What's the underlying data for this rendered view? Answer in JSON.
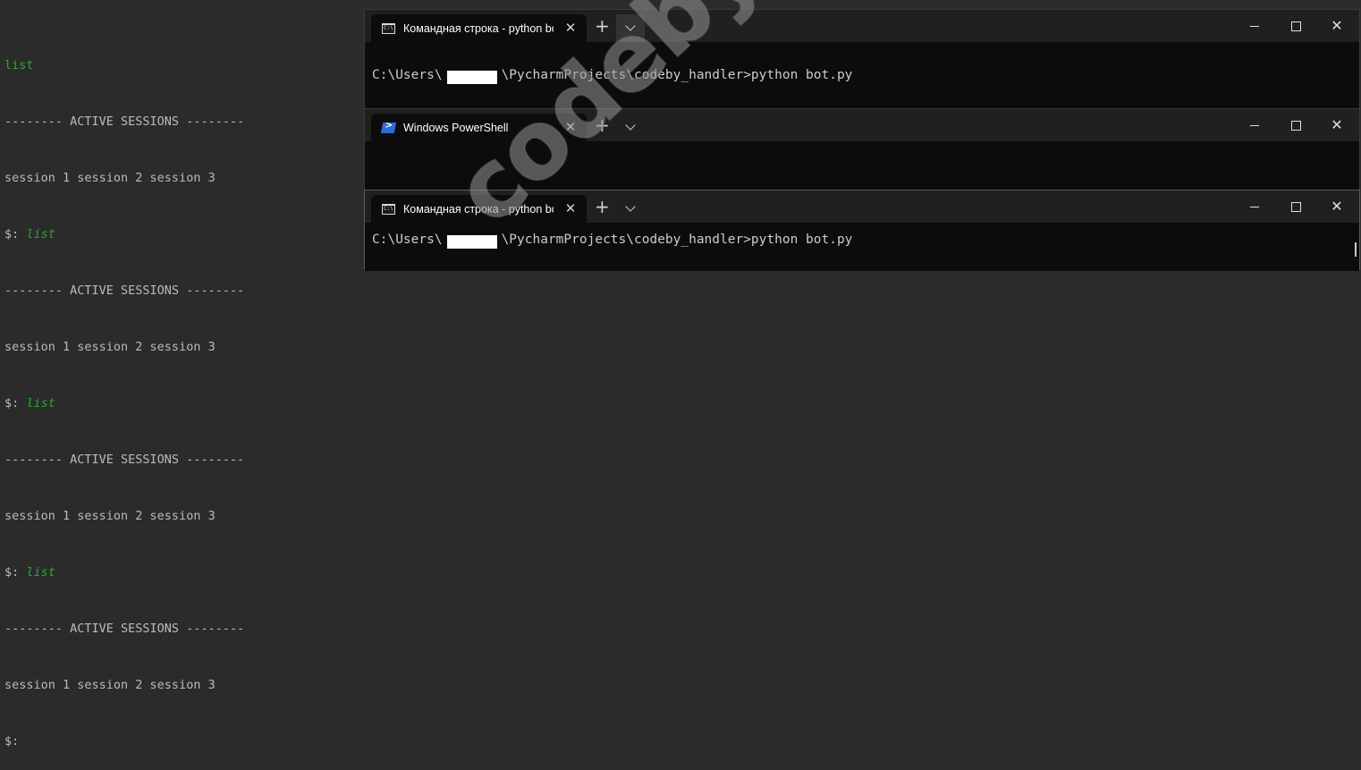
{
  "console": {
    "lines": [
      {
        "text": "list",
        "style": "cmd"
      },
      {
        "text": "-------- ACTIVE SESSIONS --------",
        "style": "plain"
      },
      {
        "text": "session 1 session 2 session 3",
        "style": "plain"
      },
      {
        "prompt": "$: ",
        "text": "list",
        "style": "prompt"
      },
      {
        "text": "-------- ACTIVE SESSIONS --------",
        "style": "plain"
      },
      {
        "text": "session 1 session 2 session 3",
        "style": "plain"
      },
      {
        "prompt": "$: ",
        "text": "list",
        "style": "prompt"
      },
      {
        "text": "-------- ACTIVE SESSIONS --------",
        "style": "plain"
      },
      {
        "text": "session 1 session 2 session 3",
        "style": "plain"
      },
      {
        "prompt": "$: ",
        "text": "list",
        "style": "prompt"
      },
      {
        "text": "-------- ACTIVE SESSIONS --------",
        "style": "plain"
      },
      {
        "text": "session 1 session 2 session 3",
        "style": "plain"
      },
      {
        "prompt": "$:",
        "text": "",
        "style": "prompt"
      }
    ]
  },
  "terminals": [
    {
      "tab_title": "Командная строка - python  bot",
      "tab_icon": "cmd-icon",
      "prompt_prefix": "C:\\Users\\",
      "prompt_suffix": "\\PycharmProjects\\codeby_handler>python bot.py"
    },
    {
      "tab_title": "Windows PowerShell",
      "tab_icon": "powershell-icon"
    },
    {
      "tab_title": "Командная строка - python  bot",
      "tab_icon": "cmd-icon",
      "prompt_prefix": "C:\\Users\\",
      "prompt_suffix": "\\PycharmProjects\\codeby_handler>python bot.py"
    }
  ],
  "controls": {
    "new_tab": "+",
    "close_tab": "✕",
    "close_window": "✕"
  },
  "watermark": "codeby.net",
  "colors": {
    "background": "#2b2b2b",
    "console_text": "#bbbbbb",
    "console_command": "#2fa52f",
    "terminal_bg": "#0c0c0c",
    "titlebar_bg": "#202020"
  }
}
